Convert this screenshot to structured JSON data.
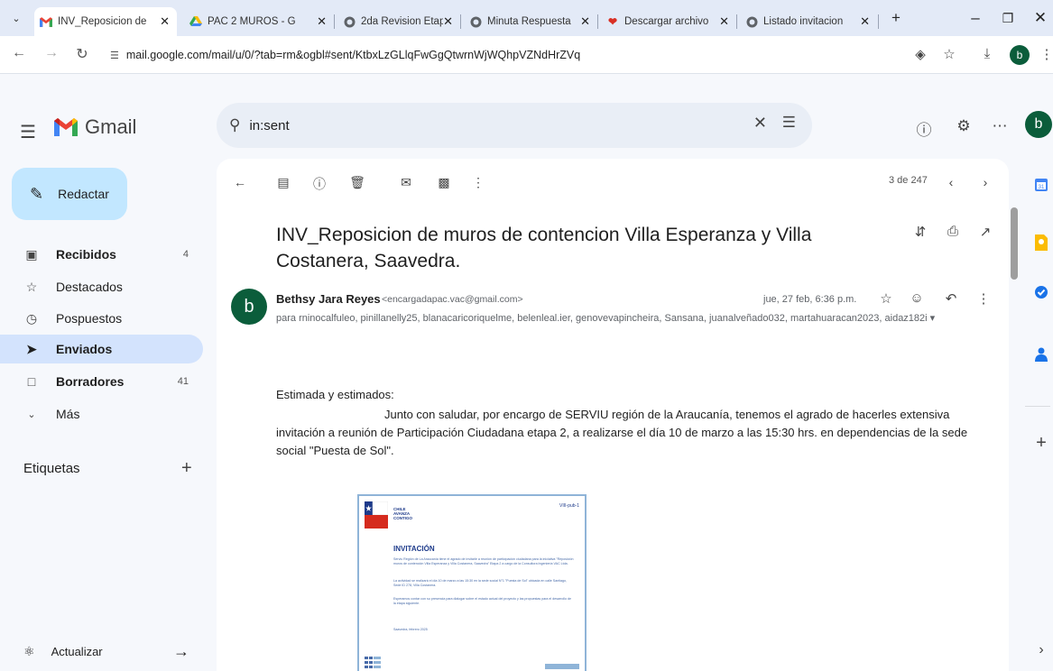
{
  "browser": {
    "tabs": [
      {
        "label": "INV_Reposicion de",
        "icon": "gmail-icon",
        "active": true
      },
      {
        "label": "PAC 2 MUROS - G",
        "icon": "drive-icon",
        "active": false
      },
      {
        "label": "2da Revision Etap",
        "icon": "globe-icon",
        "active": false
      },
      {
        "label": "Minuta Respuesta",
        "icon": "globe-icon",
        "active": false
      },
      {
        "label": "Descargar archivo",
        "icon": "heart-icon",
        "active": false
      },
      {
        "label": "Listado invitacion",
        "icon": "globe-icon",
        "active": false
      }
    ],
    "url": "mail.google.com/mail/u/0/?tab=rm&ogbl#sent/KtbxLzGLlqFwGgQtwrnWjWQhpVZNdHrZVq",
    "profile_initial": "b"
  },
  "gmail": {
    "logo_text": "Gmail",
    "search_value": "in:sent",
    "avatar_initial": "b",
    "compose_label": "Redactar",
    "nav": [
      {
        "label": "Recibidos",
        "icon": "inbox-icon",
        "count": "4",
        "bold": true
      },
      {
        "label": "Destacados",
        "icon": "star-icon",
        "count": "",
        "bold": false
      },
      {
        "label": "Pospuestos",
        "icon": "clock-icon",
        "count": "",
        "bold": false
      },
      {
        "label": "Enviados",
        "icon": "send-icon",
        "count": "",
        "bold": true
      },
      {
        "label": "Borradores",
        "icon": "draft-icon",
        "count": "41",
        "bold": true
      },
      {
        "label": "Más",
        "icon": "chevron-down-icon",
        "count": "",
        "bold": false
      }
    ],
    "labels_title": "Etiquetas",
    "update_label": "Actualizar",
    "pager": "3 de 247"
  },
  "message": {
    "subject": "INV_Reposicion de muros de contencion Villa Esperanza y Villa Costanera, Saavedra.",
    "sender_initial": "b",
    "sender_name": "Bethsy Jara Reyes",
    "sender_email": "<encargadapac.vac@gmail.com>",
    "date": "jue, 27 feb, 6:36 p.m.",
    "recipients": "para rninocalfuleo, pinillanelly25, blanacaricoriquelme, belenleal.ier, genovevapincheira, Sansana, juanalveñado032, martahuaracan2023, aidaz182i",
    "greeting": "Estimada y estimados:",
    "body": "Junto con saludar, por encargo de SERVIU región de  la Araucanía, tenemos el agrado de hacerles extensiva invitación a reunión de Participación Ciudadana etapa 2, a realizarse el día 10 de marzo a las 15:30 hrs. en dependencias de la sede social \"Puesta de Sol\"."
  },
  "invitation_preview": {
    "tag_lines": [
      "CHILE",
      "AVANZA",
      "CONTIGO"
    ],
    "corner_text": "VIII-pub-1",
    "title": "INVITACIÓN",
    "paragraphs": [
      "Serviu Región de La Araucanía tiene el agrado de invitarle a reunión de participación ciudadana para la iniciativa \"Reposición muros de contención Villa Esperanza y Villa Costanera, Saavedra\" Etapa 2 a cargo de la Consultora Ingeniería VAC Ltda.",
      "La actividad se realizará el día 10 de marzo a las 15:30 en la sede social N°1 \"Puesta de Sol\" ubicada en calle Santiago, Sede ID 278, Villa Costanera.",
      "Esperamos contar con su presencia para dialogar sobre el estado actual del proyecto y las propuestas para el desarrollo de la etapa siguiente.",
      "Saavedra, febrero 2025"
    ]
  },
  "colors": {
    "compose_bg": "#c2e7ff",
    "active_nav": "#d3e3fd",
    "search_bg": "#e9eef6",
    "avatar_bg": "#0b5d3b",
    "invite_blue": "#1d3a8a"
  }
}
